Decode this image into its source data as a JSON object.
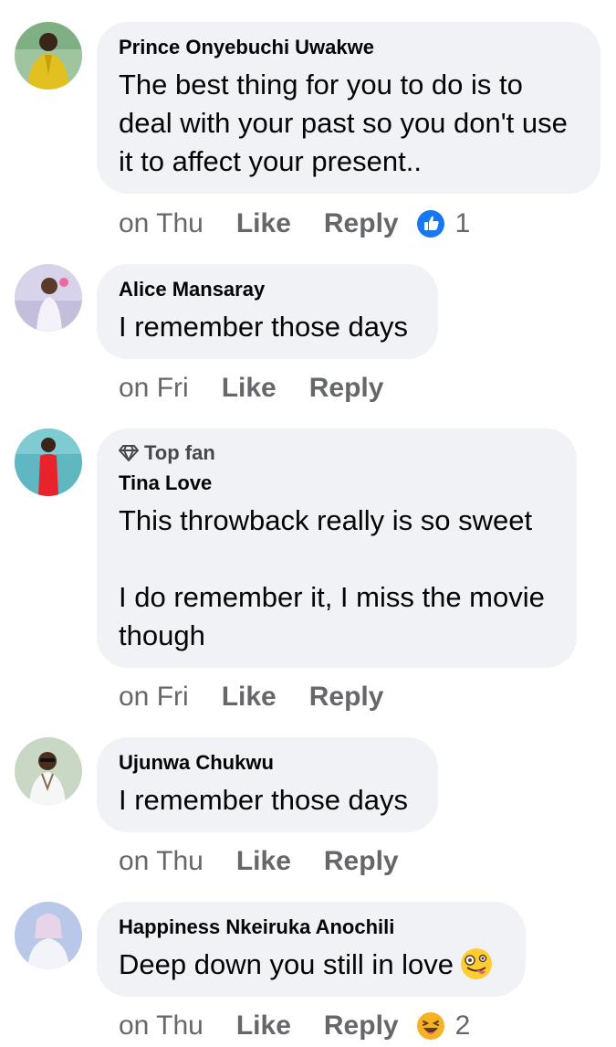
{
  "comments": [
    {
      "author": "Prince Onyebuchi Uwakwe",
      "text": "The best thing for you to do is to deal with your past so you don't use it to affect your present..",
      "time": "on Thu",
      "like": "Like",
      "reply": "Reply",
      "reaction": {
        "icon": "like-reaction-icon",
        "count": "1",
        "color": "#1877f2"
      }
    },
    {
      "author": "Alice Mansaray",
      "text": "I remember those days",
      "time": "on Fri",
      "like": "Like",
      "reply": "Reply"
    },
    {
      "badge": "Top fan",
      "badge_icon": "diamond-icon",
      "author": "Tina Love",
      "text": "This throwback really is so sweet\n\nI do remember it, I miss the movie though",
      "time": "on Fri",
      "like": "Like",
      "reply": "Reply"
    },
    {
      "author": "Ujunwa Chukwu",
      "text": "I remember those days",
      "time": "on Thu",
      "like": "Like",
      "reply": "Reply"
    },
    {
      "author": "Happiness Nkeiruka Anochili",
      "text": "Deep down you still in love",
      "text_emoji": "zany-face-emoji",
      "time": "on Thu",
      "like": "Like",
      "reply": "Reply",
      "reaction": {
        "icon": "haha-reaction-icon",
        "count": "2",
        "color": "#f7b125"
      }
    }
  ]
}
